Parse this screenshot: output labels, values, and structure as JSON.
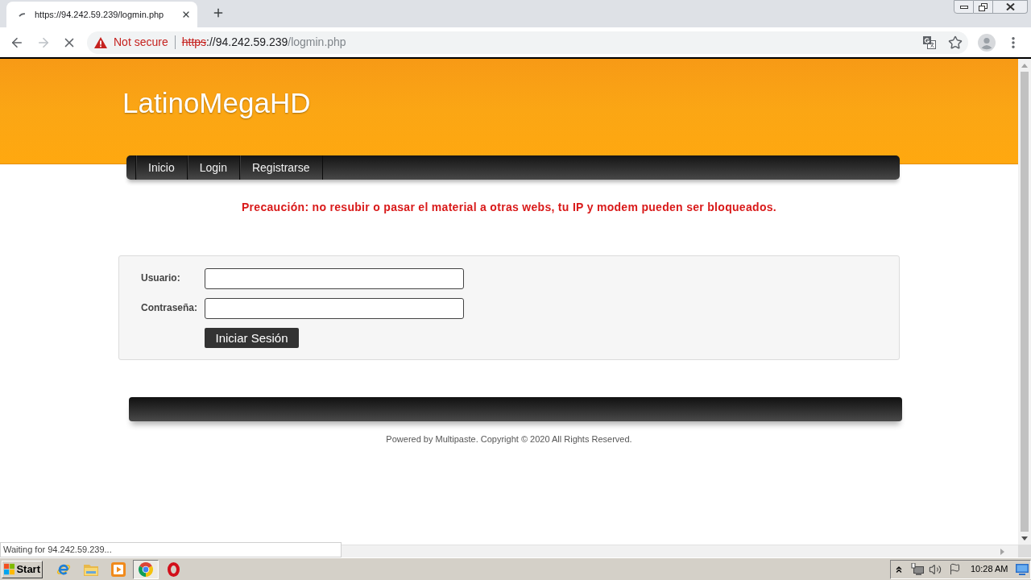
{
  "browser": {
    "tabs": [
      {
        "title": "https://94.242.59.239/logmin.php",
        "selected": true
      }
    ],
    "loading": true,
    "back": {
      "disabled": false
    },
    "forward": {
      "disabled": true
    },
    "security_label": "Not secure",
    "url_parts": [
      {
        "kind": "scheme",
        "text": "https"
      },
      {
        "kind": "host",
        "text": "://94.242.59.239"
      },
      {
        "kind": "path",
        "text": "/logmin.php"
      }
    ]
  },
  "page": {
    "site_title": "LatinoMegaHD",
    "nav": [
      {
        "label": "Inicio"
      },
      {
        "label": "Login"
      },
      {
        "label": "Registrarse"
      }
    ],
    "warning": "Precaución: no resubir o pasar el material a otras webs, tu IP y modem pueden ser bloqueados.",
    "login_form": {
      "fields": [
        {
          "label": "Usuario:"
        },
        {
          "label": "Contraseña:"
        }
      ],
      "submit": "Iniciar Sesión"
    },
    "footer": "Powered by Multipaste. Copyright © 2020 All Rights Reserved."
  },
  "status_bubble": "Waiting for 94.242.59.239...",
  "taskbar": {
    "start": "Start",
    "apps": [
      {
        "kind": "explorer",
        "selected": false
      },
      {
        "kind": "folder",
        "selected": false
      },
      {
        "kind": "player",
        "selected": false
      },
      {
        "kind": "chrome",
        "selected": true
      },
      {
        "kind": "opera",
        "selected": false
      }
    ],
    "clock": "10:28 AM"
  }
}
